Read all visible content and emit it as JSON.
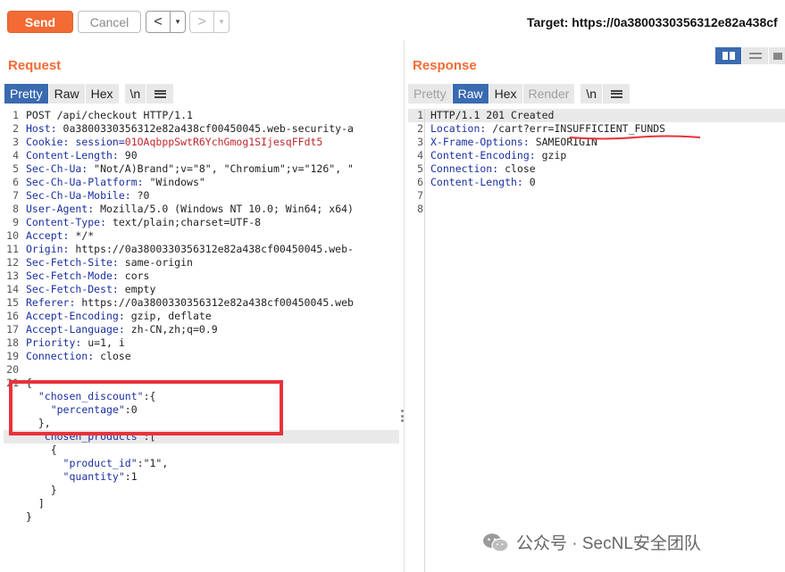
{
  "toolbar": {
    "send_label": "Send",
    "cancel_label": "Cancel",
    "back_arrow": "<",
    "forward_arrow": ">",
    "dropdown_glyph": "▾",
    "target_text": "Target: https://0a3800330356312e82a438cf"
  },
  "request": {
    "title": "Request",
    "tabs": [
      "Pretty",
      "Raw",
      "Hex",
      "\\n"
    ],
    "active_tab": "Pretty",
    "lines": [
      {
        "n": "1",
        "parts": [
          {
            "t": "POST /api/checkout HTTP/1.1",
            "c": "v"
          }
        ]
      },
      {
        "n": "2",
        "parts": [
          {
            "t": "Host: ",
            "c": "k"
          },
          {
            "t": "0a3800330356312e82a438cf00450045.web-security-a",
            "c": "v"
          }
        ]
      },
      {
        "n": "3",
        "parts": [
          {
            "t": "Cookie: ",
            "c": "k"
          },
          {
            "t": "session=",
            "c": "k"
          },
          {
            "t": "01OAqbppSwtR6YchGmog1SIjesqFFdt5",
            "c": "cv"
          }
        ]
      },
      {
        "n": "4",
        "parts": [
          {
            "t": "Content-Length: ",
            "c": "k"
          },
          {
            "t": "90",
            "c": "v"
          }
        ]
      },
      {
        "n": "5",
        "parts": [
          {
            "t": "Sec-Ch-Ua: ",
            "c": "k"
          },
          {
            "t": "\"Not/A)Brand\";v=\"8\", \"Chromium\";v=\"126\", \"",
            "c": "v"
          }
        ]
      },
      {
        "n": "6",
        "parts": [
          {
            "t": "Sec-Ch-Ua-Platform: ",
            "c": "k"
          },
          {
            "t": "\"Windows\"",
            "c": "v"
          }
        ]
      },
      {
        "n": "7",
        "parts": [
          {
            "t": "Sec-Ch-Ua-Mobile: ",
            "c": "k"
          },
          {
            "t": "?0",
            "c": "v"
          }
        ]
      },
      {
        "n": "8",
        "parts": [
          {
            "t": "User-Agent: ",
            "c": "k"
          },
          {
            "t": "Mozilla/5.0 (Windows NT 10.0; Win64; x64)",
            "c": "v"
          }
        ]
      },
      {
        "n": "9",
        "parts": [
          {
            "t": "Content-Type: ",
            "c": "k"
          },
          {
            "t": "text/plain;charset=UTF-8",
            "c": "v"
          }
        ]
      },
      {
        "n": "10",
        "parts": [
          {
            "t": "Accept: ",
            "c": "k"
          },
          {
            "t": "*/*",
            "c": "v"
          }
        ]
      },
      {
        "n": "11",
        "parts": [
          {
            "t": "Origin: ",
            "c": "k"
          },
          {
            "t": "https://0a3800330356312e82a438cf00450045.web-",
            "c": "v"
          }
        ]
      },
      {
        "n": "12",
        "parts": [
          {
            "t": "Sec-Fetch-Site: ",
            "c": "k"
          },
          {
            "t": "same-origin",
            "c": "v"
          }
        ]
      },
      {
        "n": "13",
        "parts": [
          {
            "t": "Sec-Fetch-Mode: ",
            "c": "k"
          },
          {
            "t": "cors",
            "c": "v"
          }
        ]
      },
      {
        "n": "14",
        "parts": [
          {
            "t": "Sec-Fetch-Dest: ",
            "c": "k"
          },
          {
            "t": "empty",
            "c": "v"
          }
        ]
      },
      {
        "n": "15",
        "parts": [
          {
            "t": "Referer: ",
            "c": "k"
          },
          {
            "t": "https://0a3800330356312e82a438cf00450045.web",
            "c": "v"
          }
        ]
      },
      {
        "n": "16",
        "parts": [
          {
            "t": "Accept-Encoding: ",
            "c": "k"
          },
          {
            "t": "gzip, deflate",
            "c": "v"
          }
        ]
      },
      {
        "n": "17",
        "parts": [
          {
            "t": "Accept-Language: ",
            "c": "k"
          },
          {
            "t": "zh-CN,zh;q=0.9",
            "c": "v"
          }
        ]
      },
      {
        "n": "18",
        "parts": [
          {
            "t": "Priority: ",
            "c": "k"
          },
          {
            "t": "u=1, i",
            "c": "v"
          }
        ]
      },
      {
        "n": "19",
        "parts": [
          {
            "t": "Connection: ",
            "c": "k"
          },
          {
            "t": "close",
            "c": "v"
          }
        ]
      },
      {
        "n": "20",
        "parts": []
      },
      {
        "n": "21",
        "parts": [
          {
            "t": "{",
            "c": "v"
          }
        ]
      },
      {
        "n": "",
        "parts": [
          {
            "t": "  ",
            "c": "v"
          },
          {
            "t": "\"chosen_discount\"",
            "c": "sk"
          },
          {
            "t": ":{",
            "c": "v"
          }
        ]
      },
      {
        "n": "",
        "parts": [
          {
            "t": "    ",
            "c": "v"
          },
          {
            "t": "\"percentage\"",
            "c": "sk"
          },
          {
            "t": ":0",
            "c": "v"
          }
        ]
      },
      {
        "n": "",
        "parts": [
          {
            "t": "  },",
            "c": "v"
          }
        ]
      },
      {
        "n": "",
        "hl": true,
        "parts": [
          {
            "t": "  ",
            "c": "v"
          },
          {
            "t": "\"chosen_products\"",
            "c": "sk"
          },
          {
            "t": ":[",
            "c": "v"
          }
        ]
      },
      {
        "n": "",
        "parts": [
          {
            "t": "    {",
            "c": "v"
          }
        ]
      },
      {
        "n": "",
        "parts": [
          {
            "t": "      ",
            "c": "v"
          },
          {
            "t": "\"product_id\"",
            "c": "sk"
          },
          {
            "t": ":\"1\",",
            "c": "v"
          }
        ]
      },
      {
        "n": "",
        "parts": [
          {
            "t": "      ",
            "c": "v"
          },
          {
            "t": "\"quantity\"",
            "c": "sk"
          },
          {
            "t": ":1",
            "c": "v"
          }
        ]
      },
      {
        "n": "",
        "parts": [
          {
            "t": "    }",
            "c": "v"
          }
        ]
      },
      {
        "n": "",
        "parts": [
          {
            "t": "  ]",
            "c": "v"
          }
        ]
      },
      {
        "n": "",
        "parts": [
          {
            "t": "}",
            "c": "v"
          }
        ]
      }
    ]
  },
  "response": {
    "title": "Response",
    "tabs": [
      "Pretty",
      "Raw",
      "Hex",
      "Render",
      "\\n"
    ],
    "active_tab": "Raw",
    "dim_tabs": [
      "Pretty",
      "Render"
    ],
    "lines": [
      {
        "n": "1",
        "hl": true,
        "parts": [
          {
            "t": "HTTP/1.1 201 Created",
            "c": "v"
          }
        ]
      },
      {
        "n": "2",
        "parts": [
          {
            "t": "Location: ",
            "c": "k"
          },
          {
            "t": "/cart?err=INSUFFICIENT_FUNDS",
            "c": "v"
          }
        ]
      },
      {
        "n": "3",
        "parts": [
          {
            "t": "X-Frame-Options: ",
            "c": "k"
          },
          {
            "t": "SAMEORIGIN",
            "c": "v"
          }
        ]
      },
      {
        "n": "4",
        "parts": [
          {
            "t": "Content-Encoding: ",
            "c": "k"
          },
          {
            "t": "gzip",
            "c": "v"
          }
        ]
      },
      {
        "n": "5",
        "parts": [
          {
            "t": "Connection: ",
            "c": "k"
          },
          {
            "t": "close",
            "c": "v"
          }
        ]
      },
      {
        "n": "6",
        "parts": [
          {
            "t": "Content-Length: ",
            "c": "k"
          },
          {
            "t": "0",
            "c": "v"
          }
        ]
      },
      {
        "n": "7",
        "parts": []
      },
      {
        "n": "8",
        "parts": []
      }
    ]
  },
  "watermark": {
    "text": "公众号 · SecNL安全团队"
  },
  "colors": {
    "accent": "#f26b35",
    "active_tab": "#3a6ab0",
    "annotation_red": "#e8323a"
  }
}
